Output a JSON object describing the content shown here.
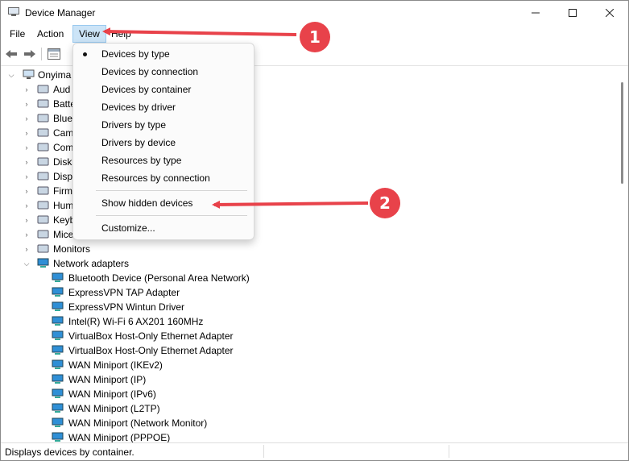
{
  "window": {
    "title": "Device Manager",
    "controls": [
      "—",
      "☐",
      "✕"
    ]
  },
  "menubar": [
    {
      "label": "File"
    },
    {
      "label": "Action"
    },
    {
      "label": "View"
    },
    {
      "label": "Help"
    }
  ],
  "tree": {
    "root": "Onyima",
    "categories": [
      {
        "label": "Aud",
        "icon": "audio-icon"
      },
      {
        "label": "Batte",
        "icon": "battery-icon"
      },
      {
        "label": "Blue",
        "icon": "bluetooth-icon"
      },
      {
        "label": "Cam",
        "icon": "camera-icon"
      },
      {
        "label": "Com",
        "icon": "computer-icon"
      },
      {
        "label": "Disk",
        "icon": "disk-icon"
      },
      {
        "label": "Disp",
        "icon": "display-icon"
      },
      {
        "label": "Firm",
        "icon": "firmware-icon"
      },
      {
        "label": "Hum",
        "icon": "hid-icon"
      },
      {
        "label": "Keyb",
        "icon": "keyboard-icon"
      },
      {
        "label": "Mice",
        "icon": "mouse-icon"
      },
      {
        "label": "Monitors",
        "icon": "monitor-icon"
      }
    ],
    "network": {
      "label": "Network adapters",
      "items": [
        "Bluetooth Device (Personal Area Network)",
        "ExpressVPN TAP Adapter",
        "ExpressVPN Wintun Driver",
        "Intel(R) Wi-Fi 6 AX201 160MHz",
        "VirtualBox Host-Only Ethernet Adapter",
        "VirtualBox Host-Only Ethernet Adapter",
        "WAN Miniport (IKEv2)",
        "WAN Miniport (IP)",
        "WAN Miniport (IPv6)",
        "WAN Miniport (L2TP)",
        "WAN Miniport (Network Monitor)",
        "WAN Miniport (PPPOE)"
      ]
    }
  },
  "view_menu": {
    "items": [
      {
        "label": "Devices by type",
        "checked": true
      },
      {
        "label": "Devices by connection"
      },
      {
        "label": "Devices by container"
      },
      {
        "label": "Devices by driver"
      },
      {
        "label": "Drivers by type"
      },
      {
        "label": "Drivers by device"
      },
      {
        "label": "Resources by type"
      },
      {
        "label": "Resources by connection"
      },
      {
        "label": "Show hidden devices"
      },
      {
        "label": "Customize..."
      }
    ]
  },
  "statusbar": {
    "text": "Displays devices by container."
  },
  "annotations": [
    {
      "number": "1"
    },
    {
      "number": "2"
    }
  ],
  "colors": {
    "annotation_red": "#e8424a",
    "menu_highlight": "#cce4f7",
    "network_icon": "#2f8fd6"
  }
}
